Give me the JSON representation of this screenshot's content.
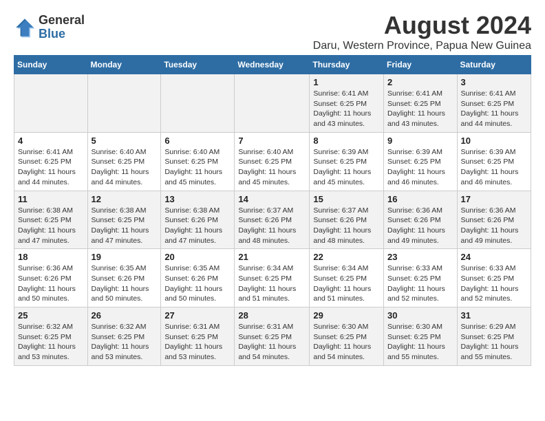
{
  "logo": {
    "general": "General",
    "blue": "Blue"
  },
  "title": "August 2024",
  "subtitle": "Daru, Western Province, Papua New Guinea",
  "days_of_week": [
    "Sunday",
    "Monday",
    "Tuesday",
    "Wednesday",
    "Thursday",
    "Friday",
    "Saturday"
  ],
  "weeks": [
    [
      {
        "day": "",
        "detail": ""
      },
      {
        "day": "",
        "detail": ""
      },
      {
        "day": "",
        "detail": ""
      },
      {
        "day": "",
        "detail": ""
      },
      {
        "day": "1",
        "detail": "Sunrise: 6:41 AM\nSunset: 6:25 PM\nDaylight: 11 hours and 43 minutes."
      },
      {
        "day": "2",
        "detail": "Sunrise: 6:41 AM\nSunset: 6:25 PM\nDaylight: 11 hours and 43 minutes."
      },
      {
        "day": "3",
        "detail": "Sunrise: 6:41 AM\nSunset: 6:25 PM\nDaylight: 11 hours and 44 minutes."
      }
    ],
    [
      {
        "day": "4",
        "detail": "Sunrise: 6:41 AM\nSunset: 6:25 PM\nDaylight: 11 hours and 44 minutes."
      },
      {
        "day": "5",
        "detail": "Sunrise: 6:40 AM\nSunset: 6:25 PM\nDaylight: 11 hours and 44 minutes."
      },
      {
        "day": "6",
        "detail": "Sunrise: 6:40 AM\nSunset: 6:25 PM\nDaylight: 11 hours and 45 minutes."
      },
      {
        "day": "7",
        "detail": "Sunrise: 6:40 AM\nSunset: 6:25 PM\nDaylight: 11 hours and 45 minutes."
      },
      {
        "day": "8",
        "detail": "Sunrise: 6:39 AM\nSunset: 6:25 PM\nDaylight: 11 hours and 45 minutes."
      },
      {
        "day": "9",
        "detail": "Sunrise: 6:39 AM\nSunset: 6:25 PM\nDaylight: 11 hours and 46 minutes."
      },
      {
        "day": "10",
        "detail": "Sunrise: 6:39 AM\nSunset: 6:25 PM\nDaylight: 11 hours and 46 minutes."
      }
    ],
    [
      {
        "day": "11",
        "detail": "Sunrise: 6:38 AM\nSunset: 6:25 PM\nDaylight: 11 hours and 47 minutes."
      },
      {
        "day": "12",
        "detail": "Sunrise: 6:38 AM\nSunset: 6:25 PM\nDaylight: 11 hours and 47 minutes."
      },
      {
        "day": "13",
        "detail": "Sunrise: 6:38 AM\nSunset: 6:26 PM\nDaylight: 11 hours and 47 minutes."
      },
      {
        "day": "14",
        "detail": "Sunrise: 6:37 AM\nSunset: 6:26 PM\nDaylight: 11 hours and 48 minutes."
      },
      {
        "day": "15",
        "detail": "Sunrise: 6:37 AM\nSunset: 6:26 PM\nDaylight: 11 hours and 48 minutes."
      },
      {
        "day": "16",
        "detail": "Sunrise: 6:36 AM\nSunset: 6:26 PM\nDaylight: 11 hours and 49 minutes."
      },
      {
        "day": "17",
        "detail": "Sunrise: 6:36 AM\nSunset: 6:26 PM\nDaylight: 11 hours and 49 minutes."
      }
    ],
    [
      {
        "day": "18",
        "detail": "Sunrise: 6:36 AM\nSunset: 6:26 PM\nDaylight: 11 hours and 50 minutes."
      },
      {
        "day": "19",
        "detail": "Sunrise: 6:35 AM\nSunset: 6:26 PM\nDaylight: 11 hours and 50 minutes."
      },
      {
        "day": "20",
        "detail": "Sunrise: 6:35 AM\nSunset: 6:26 PM\nDaylight: 11 hours and 50 minutes."
      },
      {
        "day": "21",
        "detail": "Sunrise: 6:34 AM\nSunset: 6:25 PM\nDaylight: 11 hours and 51 minutes."
      },
      {
        "day": "22",
        "detail": "Sunrise: 6:34 AM\nSunset: 6:25 PM\nDaylight: 11 hours and 51 minutes."
      },
      {
        "day": "23",
        "detail": "Sunrise: 6:33 AM\nSunset: 6:25 PM\nDaylight: 11 hours and 52 minutes."
      },
      {
        "day": "24",
        "detail": "Sunrise: 6:33 AM\nSunset: 6:25 PM\nDaylight: 11 hours and 52 minutes."
      }
    ],
    [
      {
        "day": "25",
        "detail": "Sunrise: 6:32 AM\nSunset: 6:25 PM\nDaylight: 11 hours and 53 minutes."
      },
      {
        "day": "26",
        "detail": "Sunrise: 6:32 AM\nSunset: 6:25 PM\nDaylight: 11 hours and 53 minutes."
      },
      {
        "day": "27",
        "detail": "Sunrise: 6:31 AM\nSunset: 6:25 PM\nDaylight: 11 hours and 53 minutes."
      },
      {
        "day": "28",
        "detail": "Sunrise: 6:31 AM\nSunset: 6:25 PM\nDaylight: 11 hours and 54 minutes."
      },
      {
        "day": "29",
        "detail": "Sunrise: 6:30 AM\nSunset: 6:25 PM\nDaylight: 11 hours and 54 minutes."
      },
      {
        "day": "30",
        "detail": "Sunrise: 6:30 AM\nSunset: 6:25 PM\nDaylight: 11 hours and 55 minutes."
      },
      {
        "day": "31",
        "detail": "Sunrise: 6:29 AM\nSunset: 6:25 PM\nDaylight: 11 hours and 55 minutes."
      }
    ]
  ]
}
